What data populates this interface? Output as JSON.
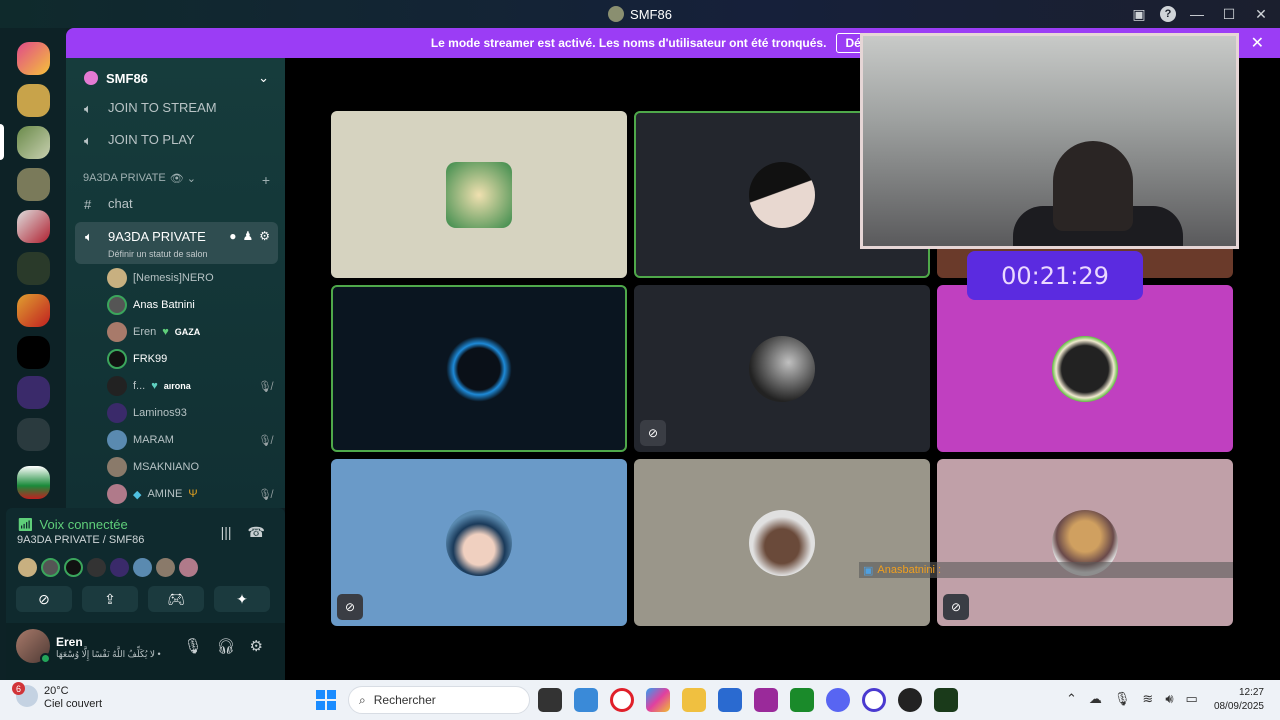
{
  "window": {
    "title": "SMF86"
  },
  "banner": {
    "message": "Le mode streamer est activé. Les noms d'utilisateur ont été tronqués.",
    "button": "Désactiver",
    "close": "✕"
  },
  "sidebar": {
    "server_name": "SMF86",
    "channels_top": [
      "JOIN TO STREAM",
      "JOIN TO PLAY"
    ],
    "category": "9A3DA PRIVATE",
    "text_channel": "chat",
    "active_channel": {
      "name": "9A3DA PRIVATE",
      "status_hint": "Définir un statut de salon"
    },
    "voice_users": [
      {
        "name": "[Nemesis]NERO",
        "tag": "",
        "muted": false
      },
      {
        "name": "Anas Batnini",
        "tag": "",
        "muted": false
      },
      {
        "name": "Eren",
        "tag": "GAZA",
        "muted": false
      },
      {
        "name": "FRK99",
        "tag": "",
        "muted": false
      },
      {
        "name": "f...",
        "tag": "aırona",
        "muted": true
      },
      {
        "name": "Laminos93",
        "tag": "",
        "muted": false
      },
      {
        "name": "MARAM",
        "tag": "",
        "muted": true
      },
      {
        "name": "MSAKNIANO",
        "tag": "",
        "muted": false
      },
      {
        "name": "AMINE",
        "tag": "",
        "muted": true
      }
    ]
  },
  "voice_panel": {
    "status": "Voix connectée",
    "location": "9A3DA PRIVATE / SMF86"
  },
  "user_panel": {
    "username": "Eren",
    "status": "لا يُكَلِّفُ اللَّهُ نَفْسًا إِلَّا وُسْعَهَا •"
  },
  "stage": {
    "timer": "00:21:29",
    "overlay_name": "Anasbatnini :"
  },
  "taskbar": {
    "weather_temp": "20°C",
    "weather_desc": "Ciel couvert",
    "weather_badge": "6",
    "search_placeholder": "Rechercher",
    "time": "12:27",
    "date": "08/09/2025"
  },
  "colors": {
    "banner": "#9b3df5",
    "timer": "#5b2be0",
    "speaking_border": "#4fa84a",
    "online": "#23a55a"
  }
}
